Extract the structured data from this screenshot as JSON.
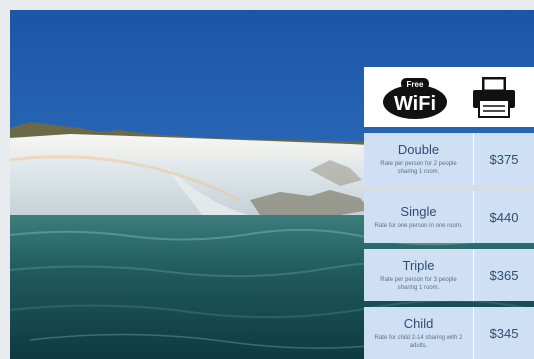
{
  "amenities": {
    "wifi": {
      "icon": "wifi-icon",
      "badge": "Free",
      "label": "WiFi"
    },
    "printer": {
      "icon": "printer-icon"
    }
  },
  "rates": [
    {
      "name": "Double",
      "description": "Rate per person for 2 people sharing 1 room.",
      "price": "$375"
    },
    {
      "name": "Single",
      "description": "Rate for one person in one room.",
      "price": "$440"
    },
    {
      "name": "Triple",
      "description": "Rate per person for 3 people sharing 1 room.",
      "price": "$365"
    },
    {
      "name": "Child",
      "description": "Rate for child 2-14 sharing with 2 adults.",
      "price": "$345"
    }
  ],
  "colors": {
    "page_bg": "#e9ecef",
    "row_bg": "#cfe0f4",
    "text": "#2e4d73"
  }
}
